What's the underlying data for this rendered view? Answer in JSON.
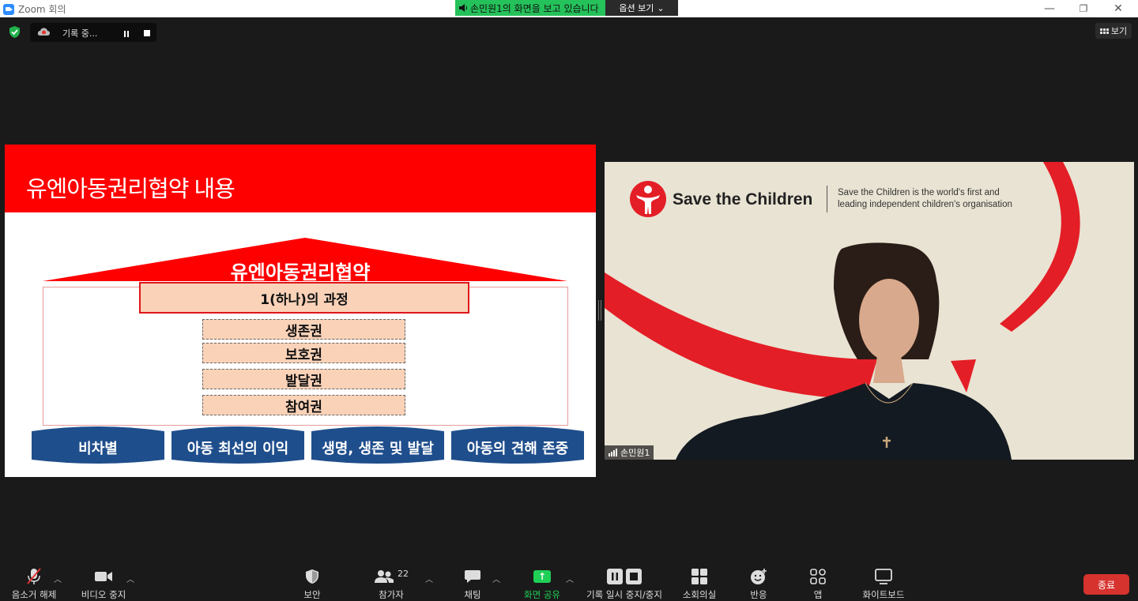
{
  "window": {
    "title": "Zoom 회의",
    "sharing_banner": "손민원1의 화면을 보고 있습니다",
    "view_options": "옵션 보기",
    "minimize": "—",
    "restore": "❐",
    "close": "✕"
  },
  "recording": {
    "status": "기록 중..."
  },
  "view_button": "보기",
  "slide": {
    "header_title": "유엔아동권리협약 내용",
    "roof_title": "유엔아동권리협약",
    "process": "1(하나)의 과정",
    "rights": [
      "생존권",
      "보호권",
      "발달권",
      "참여권"
    ],
    "principles": [
      "비차별",
      "아동 최선의 이익",
      "생명, 생존 및 발달",
      "아동의 견해 존중"
    ]
  },
  "speaker": {
    "org_name": "Save the Children",
    "tagline": "Save the Children is the world's first and leading independent children's organisation",
    "name_tag": "손민원1"
  },
  "toolbar": {
    "mute": "음소거 해제",
    "video": "비디오 중지",
    "security": "보안",
    "participants": "참가자",
    "participants_count": "22",
    "chat": "채팅",
    "share": "화면 공유",
    "record": "기록 일시 중지/중지",
    "breakout": "소회의실",
    "reactions": "반응",
    "apps": "앱",
    "whiteboard": "화이트보드",
    "end": "종료"
  },
  "colors": {
    "slide_red": "#ff0000",
    "pillar_navy": "#1f4e8c",
    "box_peach": "#fad2b8",
    "share_green": "#1fcf56",
    "end_red": "#d6322e",
    "banner_green": "#25c15a"
  }
}
